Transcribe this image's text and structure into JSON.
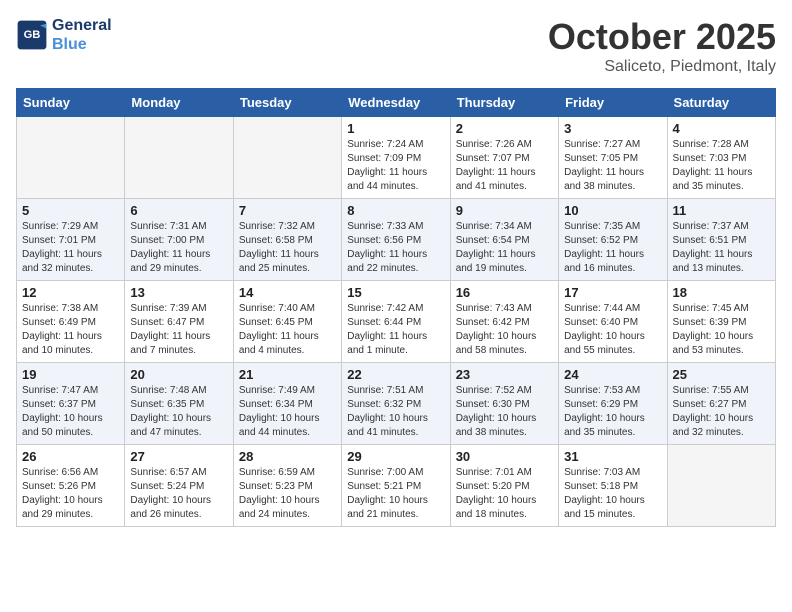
{
  "header": {
    "logo_line1": "General",
    "logo_line2": "Blue",
    "month": "October 2025",
    "location": "Saliceto, Piedmont, Italy"
  },
  "weekdays": [
    "Sunday",
    "Monday",
    "Tuesday",
    "Wednesday",
    "Thursday",
    "Friday",
    "Saturday"
  ],
  "weeks": [
    [
      {
        "day": "",
        "info": ""
      },
      {
        "day": "",
        "info": ""
      },
      {
        "day": "",
        "info": ""
      },
      {
        "day": "1",
        "info": "Sunrise: 7:24 AM\nSunset: 7:09 PM\nDaylight: 11 hours and 44 minutes."
      },
      {
        "day": "2",
        "info": "Sunrise: 7:26 AM\nSunset: 7:07 PM\nDaylight: 11 hours and 41 minutes."
      },
      {
        "day": "3",
        "info": "Sunrise: 7:27 AM\nSunset: 7:05 PM\nDaylight: 11 hours and 38 minutes."
      },
      {
        "day": "4",
        "info": "Sunrise: 7:28 AM\nSunset: 7:03 PM\nDaylight: 11 hours and 35 minutes."
      }
    ],
    [
      {
        "day": "5",
        "info": "Sunrise: 7:29 AM\nSunset: 7:01 PM\nDaylight: 11 hours and 32 minutes."
      },
      {
        "day": "6",
        "info": "Sunrise: 7:31 AM\nSunset: 7:00 PM\nDaylight: 11 hours and 29 minutes."
      },
      {
        "day": "7",
        "info": "Sunrise: 7:32 AM\nSunset: 6:58 PM\nDaylight: 11 hours and 25 minutes."
      },
      {
        "day": "8",
        "info": "Sunrise: 7:33 AM\nSunset: 6:56 PM\nDaylight: 11 hours and 22 minutes."
      },
      {
        "day": "9",
        "info": "Sunrise: 7:34 AM\nSunset: 6:54 PM\nDaylight: 11 hours and 19 minutes."
      },
      {
        "day": "10",
        "info": "Sunrise: 7:35 AM\nSunset: 6:52 PM\nDaylight: 11 hours and 16 minutes."
      },
      {
        "day": "11",
        "info": "Sunrise: 7:37 AM\nSunset: 6:51 PM\nDaylight: 11 hours and 13 minutes."
      }
    ],
    [
      {
        "day": "12",
        "info": "Sunrise: 7:38 AM\nSunset: 6:49 PM\nDaylight: 11 hours and 10 minutes."
      },
      {
        "day": "13",
        "info": "Sunrise: 7:39 AM\nSunset: 6:47 PM\nDaylight: 11 hours and 7 minutes."
      },
      {
        "day": "14",
        "info": "Sunrise: 7:40 AM\nSunset: 6:45 PM\nDaylight: 11 hours and 4 minutes."
      },
      {
        "day": "15",
        "info": "Sunrise: 7:42 AM\nSunset: 6:44 PM\nDaylight: 11 hours and 1 minute."
      },
      {
        "day": "16",
        "info": "Sunrise: 7:43 AM\nSunset: 6:42 PM\nDaylight: 10 hours and 58 minutes."
      },
      {
        "day": "17",
        "info": "Sunrise: 7:44 AM\nSunset: 6:40 PM\nDaylight: 10 hours and 55 minutes."
      },
      {
        "day": "18",
        "info": "Sunrise: 7:45 AM\nSunset: 6:39 PM\nDaylight: 10 hours and 53 minutes."
      }
    ],
    [
      {
        "day": "19",
        "info": "Sunrise: 7:47 AM\nSunset: 6:37 PM\nDaylight: 10 hours and 50 minutes."
      },
      {
        "day": "20",
        "info": "Sunrise: 7:48 AM\nSunset: 6:35 PM\nDaylight: 10 hours and 47 minutes."
      },
      {
        "day": "21",
        "info": "Sunrise: 7:49 AM\nSunset: 6:34 PM\nDaylight: 10 hours and 44 minutes."
      },
      {
        "day": "22",
        "info": "Sunrise: 7:51 AM\nSunset: 6:32 PM\nDaylight: 10 hours and 41 minutes."
      },
      {
        "day": "23",
        "info": "Sunrise: 7:52 AM\nSunset: 6:30 PM\nDaylight: 10 hours and 38 minutes."
      },
      {
        "day": "24",
        "info": "Sunrise: 7:53 AM\nSunset: 6:29 PM\nDaylight: 10 hours and 35 minutes."
      },
      {
        "day": "25",
        "info": "Sunrise: 7:55 AM\nSunset: 6:27 PM\nDaylight: 10 hours and 32 minutes."
      }
    ],
    [
      {
        "day": "26",
        "info": "Sunrise: 6:56 AM\nSunset: 5:26 PM\nDaylight: 10 hours and 29 minutes."
      },
      {
        "day": "27",
        "info": "Sunrise: 6:57 AM\nSunset: 5:24 PM\nDaylight: 10 hours and 26 minutes."
      },
      {
        "day": "28",
        "info": "Sunrise: 6:59 AM\nSunset: 5:23 PM\nDaylight: 10 hours and 24 minutes."
      },
      {
        "day": "29",
        "info": "Sunrise: 7:00 AM\nSunset: 5:21 PM\nDaylight: 10 hours and 21 minutes."
      },
      {
        "day": "30",
        "info": "Sunrise: 7:01 AM\nSunset: 5:20 PM\nDaylight: 10 hours and 18 minutes."
      },
      {
        "day": "31",
        "info": "Sunrise: 7:03 AM\nSunset: 5:18 PM\nDaylight: 10 hours and 15 minutes."
      },
      {
        "day": "",
        "info": ""
      }
    ]
  ]
}
